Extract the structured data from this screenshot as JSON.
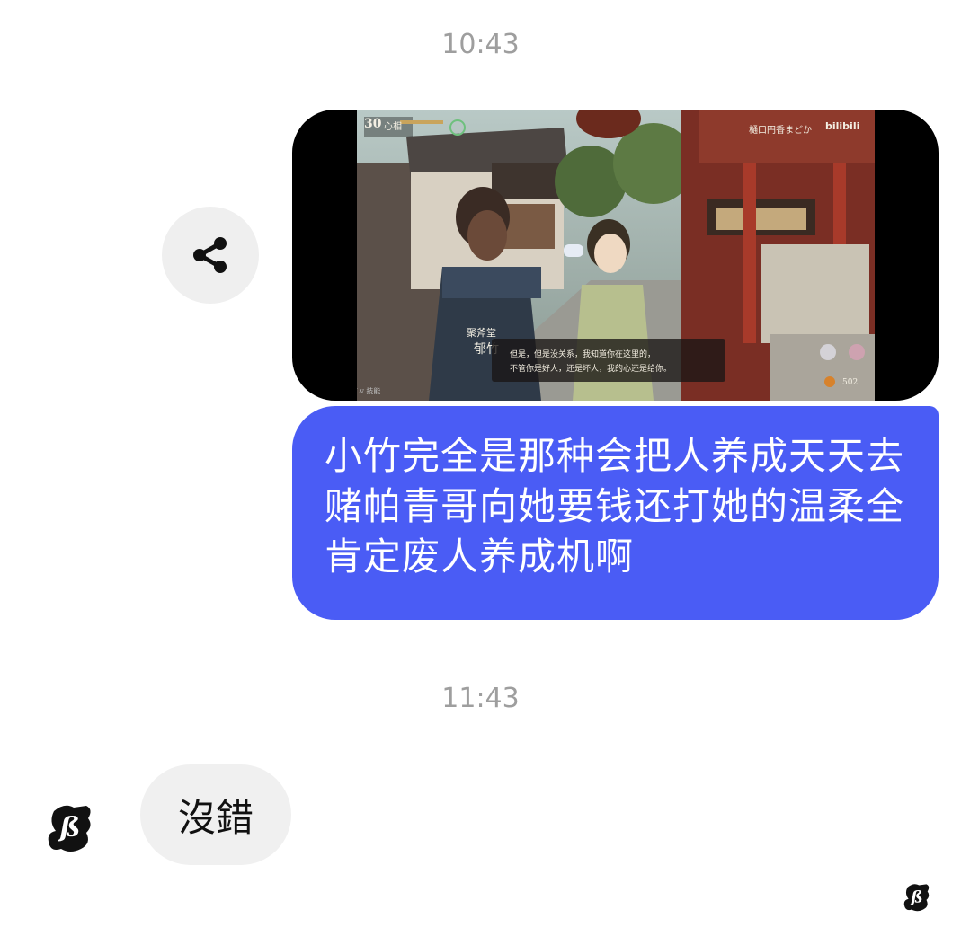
{
  "chat": {
    "timestamp_1": "10:43",
    "timestamp_2": "11:43",
    "share_icon": "share-icon",
    "image_attachment": {
      "hud": {
        "day_number": "30",
        "stat_label": "心相",
        "brand_text": "樋口円香まどか",
        "brand_logo": "bilibili"
      },
      "speaker_line_1": "聚斧堂",
      "speaker_line_2": "郁竹",
      "dialogue_line_1": "但是，但是没关系，我知道你在这里的，",
      "dialogue_line_2": "不管你是好人，还是坏人，我的心还是给你。",
      "currency_value": "502",
      "footer_label": "Lv 技能"
    },
    "outgoing_message": "小竹完全是那种会把人养成天天去赌帕青哥向她要钱还打她的温柔全肯定废人养成机啊",
    "incoming_message": "沒錯",
    "avatar_icon": "sb-logo-icon",
    "read_receipt_icon": "sb-logo-icon"
  },
  "colors": {
    "outgoing_bubble": "#4a5cf5",
    "incoming_bubble": "#f0f0f0",
    "timestamp": "#9e9e9e",
    "share_button_bg": "#efefef"
  }
}
